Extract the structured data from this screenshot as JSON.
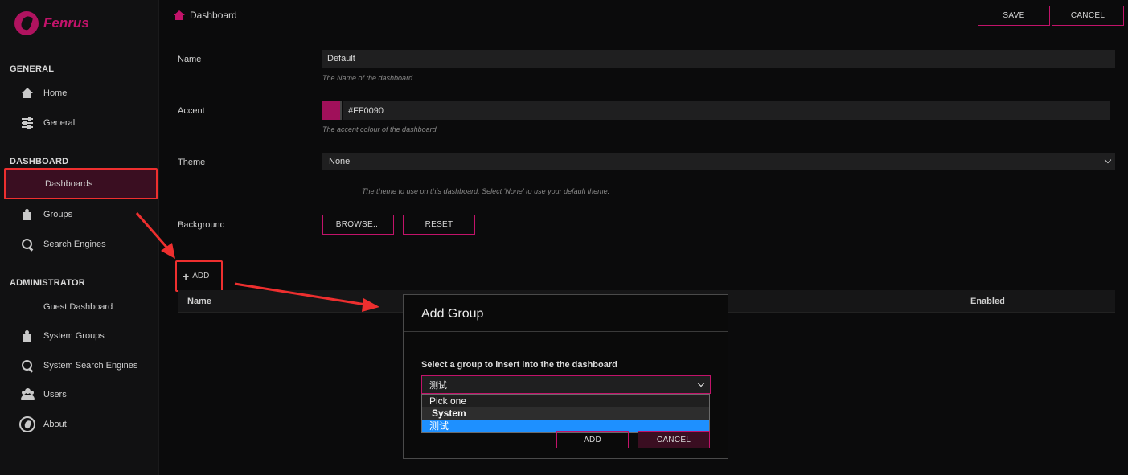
{
  "app": {
    "name": "Fenrus",
    "accent": "#c2136a"
  },
  "sidebar": {
    "sections": [
      {
        "title": "GENERAL",
        "items": [
          {
            "label": "Home",
            "icon": "home-icon"
          },
          {
            "label": "General",
            "icon": "sliders-icon"
          }
        ]
      },
      {
        "title": "DASHBOARD",
        "items": [
          {
            "label": "Dashboards",
            "icon": "grid-icon",
            "active": true
          },
          {
            "label": "Groups",
            "icon": "puzzle-icon"
          },
          {
            "label": "Search Engines",
            "icon": "search-icon"
          }
        ]
      },
      {
        "title": "ADMINISTRATOR",
        "items": [
          {
            "label": "Guest Dashboard",
            "icon": "grid-icon"
          },
          {
            "label": "System Groups",
            "icon": "puzzle-icon"
          },
          {
            "label": "System Search Engines",
            "icon": "search-icon"
          },
          {
            "label": "Users",
            "icon": "users-icon"
          },
          {
            "label": "About",
            "icon": "fenrus-logo-icon"
          }
        ]
      }
    ]
  },
  "header": {
    "title": "Dashboard",
    "save_label": "SAVE",
    "cancel_label": "CANCEL"
  },
  "form": {
    "name": {
      "label": "Name",
      "value": "Default",
      "help": "The Name of the dashboard"
    },
    "accent": {
      "label": "Accent",
      "value": "#FF0090",
      "swatch_color": "#a0105a",
      "help": "The accent colour of the dashboard"
    },
    "theme": {
      "label": "Theme",
      "value": "None",
      "help": "The theme to use on this dashboard.  Select 'None' to use your default theme."
    },
    "background": {
      "label": "Background",
      "browse_label": "BROWSE...",
      "reset_label": "RESET"
    }
  },
  "groups": {
    "add_label": "ADD",
    "columns": [
      "Name",
      "Enabled"
    ]
  },
  "modal": {
    "title": "Add Group",
    "select_label": "Select a group to insert into the the dashboard",
    "selected_value": "测试",
    "options": [
      {
        "label": "Pick one",
        "type": "option"
      },
      {
        "label": "System",
        "type": "group"
      },
      {
        "label": "测试",
        "type": "option",
        "selected": true
      }
    ],
    "add_label": "ADD",
    "cancel_label": "CANCEL"
  },
  "annotations": {
    "highlight_color": "#ee2f2f"
  }
}
